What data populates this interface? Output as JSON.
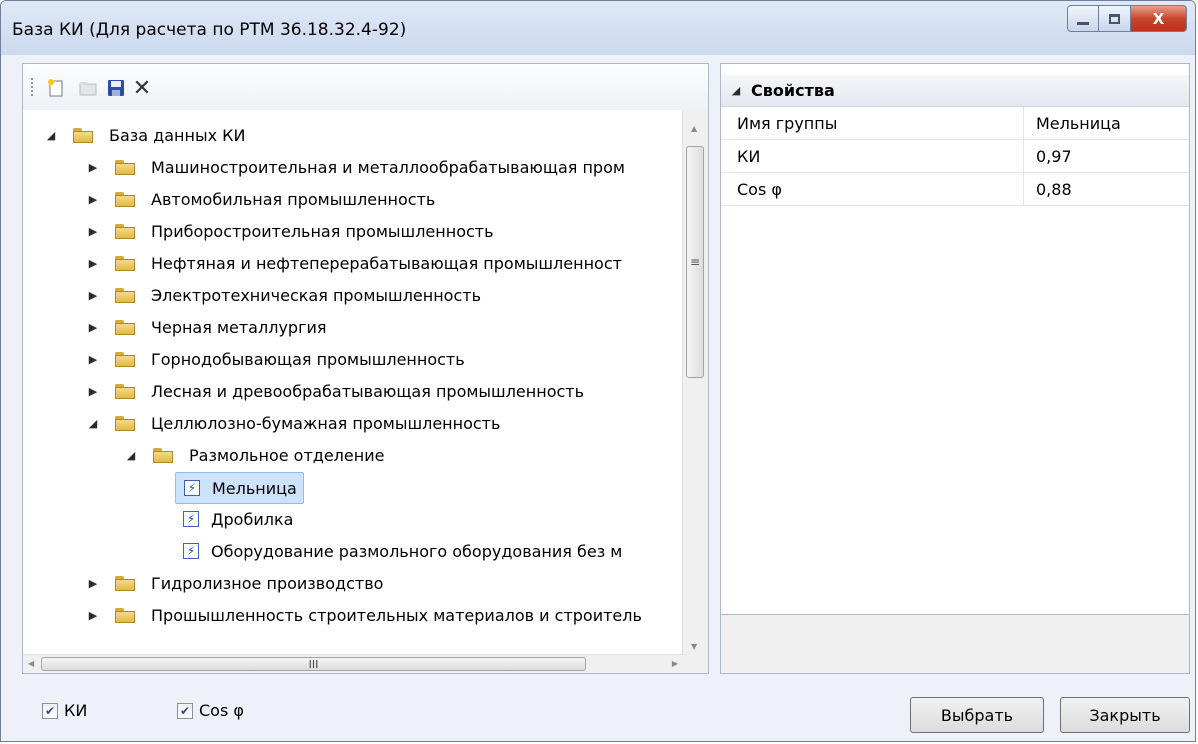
{
  "window": {
    "title": "База КИ (Для расчета по РТМ 36.18.32.4-92)",
    "close_glyph": "X"
  },
  "toolbar": {
    "icons": [
      "new-icon",
      "open-icon",
      "save-icon",
      "delete-icon"
    ],
    "delete_glyph": "✕"
  },
  "tree": {
    "root": "База данных КИ",
    "items": [
      "Машиностроительная и металлообрабатывающая пром",
      "Автомобильная промышленность",
      "Приборостроительная промышленность",
      "Нефтяная и нефтеперерабатывающая промышленност",
      "Электротехническая промышленность",
      "Черная металлургия",
      "Горнодобывающая промышленность",
      "Лесная и древообрабатывающая промышленность",
      "Целлюлозно-бумажная промышленность"
    ],
    "subgroup": "Размольное отделение",
    "leaves": [
      "Мельница",
      "Дробилка",
      "Оборудование размольного оборудования без м"
    ],
    "after": [
      "Гидролизное производство",
      "Прошышленность строительных материалов и строитель"
    ]
  },
  "scroll": {
    "vthumb": "≡",
    "hthumb": "III"
  },
  "properties": {
    "header": "Свойства",
    "rows": [
      {
        "name": "Имя группы",
        "value": "Мельница"
      },
      {
        "name": "КИ",
        "value": "0,97"
      },
      {
        "name": "Cos φ",
        "value": "0,88"
      }
    ]
  },
  "options": {
    "ki_label": "КИ",
    "ki_checked": true,
    "cos_label": "Cos φ",
    "cos_checked": true
  },
  "buttons": {
    "select": "Выбрать",
    "close": "Закрыть"
  },
  "colors": {
    "selection": "#cde3fb",
    "close_button": "#c8472b"
  }
}
